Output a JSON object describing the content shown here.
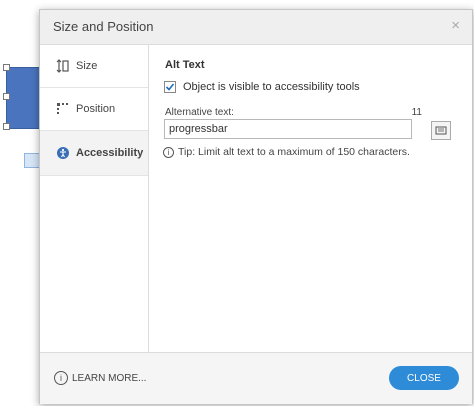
{
  "dialog": {
    "title": "Size and Position",
    "close_glyph": "×"
  },
  "sidebar": {
    "items": [
      {
        "label": "Size",
        "icon": "resize-vertical-icon"
      },
      {
        "label": "Position",
        "icon": "position-icon"
      },
      {
        "label": "Accessibility",
        "icon": "accessibility-icon"
      }
    ]
  },
  "alt_text": {
    "heading": "Alt Text",
    "checkbox_label": "Object is visible to accessibility tools",
    "checkbox_checked": true,
    "field_label": "Alternative text:",
    "char_count": "11",
    "value": "progressbar",
    "tip": "Tip: Limit alt text to a maximum of 150 characters."
  },
  "footer": {
    "learn_more": "LEARN MORE...",
    "close_label": "CLOSE"
  },
  "colors": {
    "accent": "#2d8bd7",
    "shape_fill": "#4a74bd"
  }
}
